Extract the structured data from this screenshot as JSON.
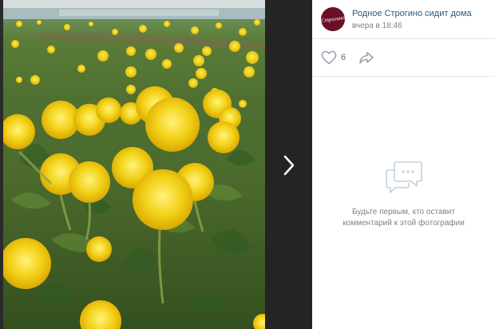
{
  "post": {
    "author": "Родное Строгино сидит дома",
    "time": "вчера в 18:46",
    "avatar_text": "Строгино"
  },
  "actions": {
    "like_count": "6"
  },
  "comments": {
    "empty_line1": "Будьте первым, кто оставит",
    "empty_line2": "комментарий к этой фотографии"
  },
  "photo": {
    "subject": "dandelions"
  },
  "colors": {
    "link": "#2a5885",
    "muted": "#828282",
    "avatar_bg": "#6a0f26",
    "viewer_bg": "#000000"
  }
}
